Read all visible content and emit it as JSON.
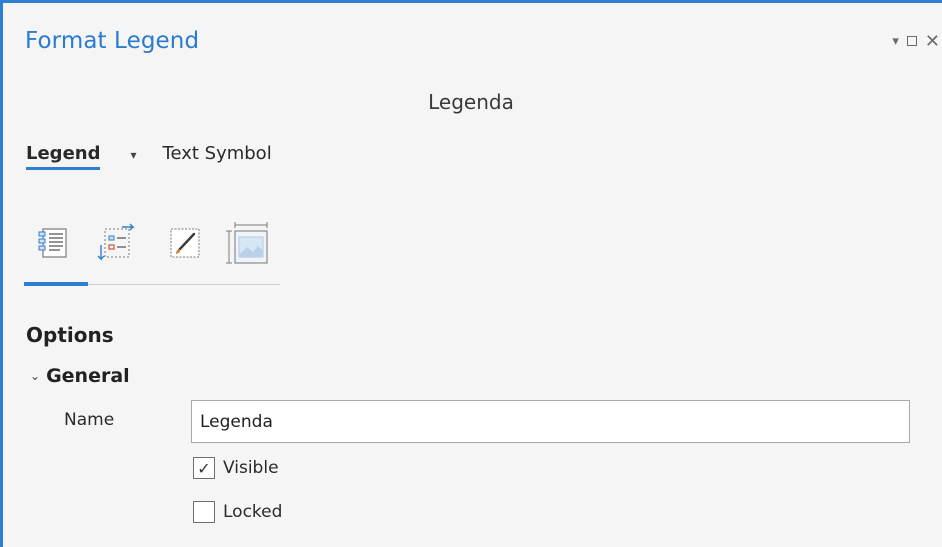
{
  "pane": {
    "title": "Format Legend",
    "element_name": "Legenda",
    "controls": {
      "menu": "▾",
      "maximize": "",
      "close": "✕"
    }
  },
  "tabs": [
    {
      "label": "Legend",
      "active": true
    },
    {
      "label": "Text Symbol",
      "active": false
    }
  ],
  "tab_dropdown": "▾",
  "icon_tabs": [
    {
      "icon": "legend-options-icon",
      "active": true
    },
    {
      "icon": "legend-arrangement-icon",
      "active": false
    },
    {
      "icon": "symbol-display-icon",
      "active": false
    },
    {
      "icon": "placement-icon",
      "active": false
    }
  ],
  "options": {
    "header": "Options",
    "general": {
      "header": "General",
      "name_label": "Name",
      "name_value": "Legenda",
      "visible_label": "Visible",
      "visible_checked": true,
      "locked_label": "Locked",
      "locked_checked": false,
      "check_mark": "✓",
      "chevron": "⌄"
    }
  },
  "colors": {
    "accent": "#2e7fd0",
    "title": "#2b7bd0",
    "background": "#f5f5f5"
  }
}
